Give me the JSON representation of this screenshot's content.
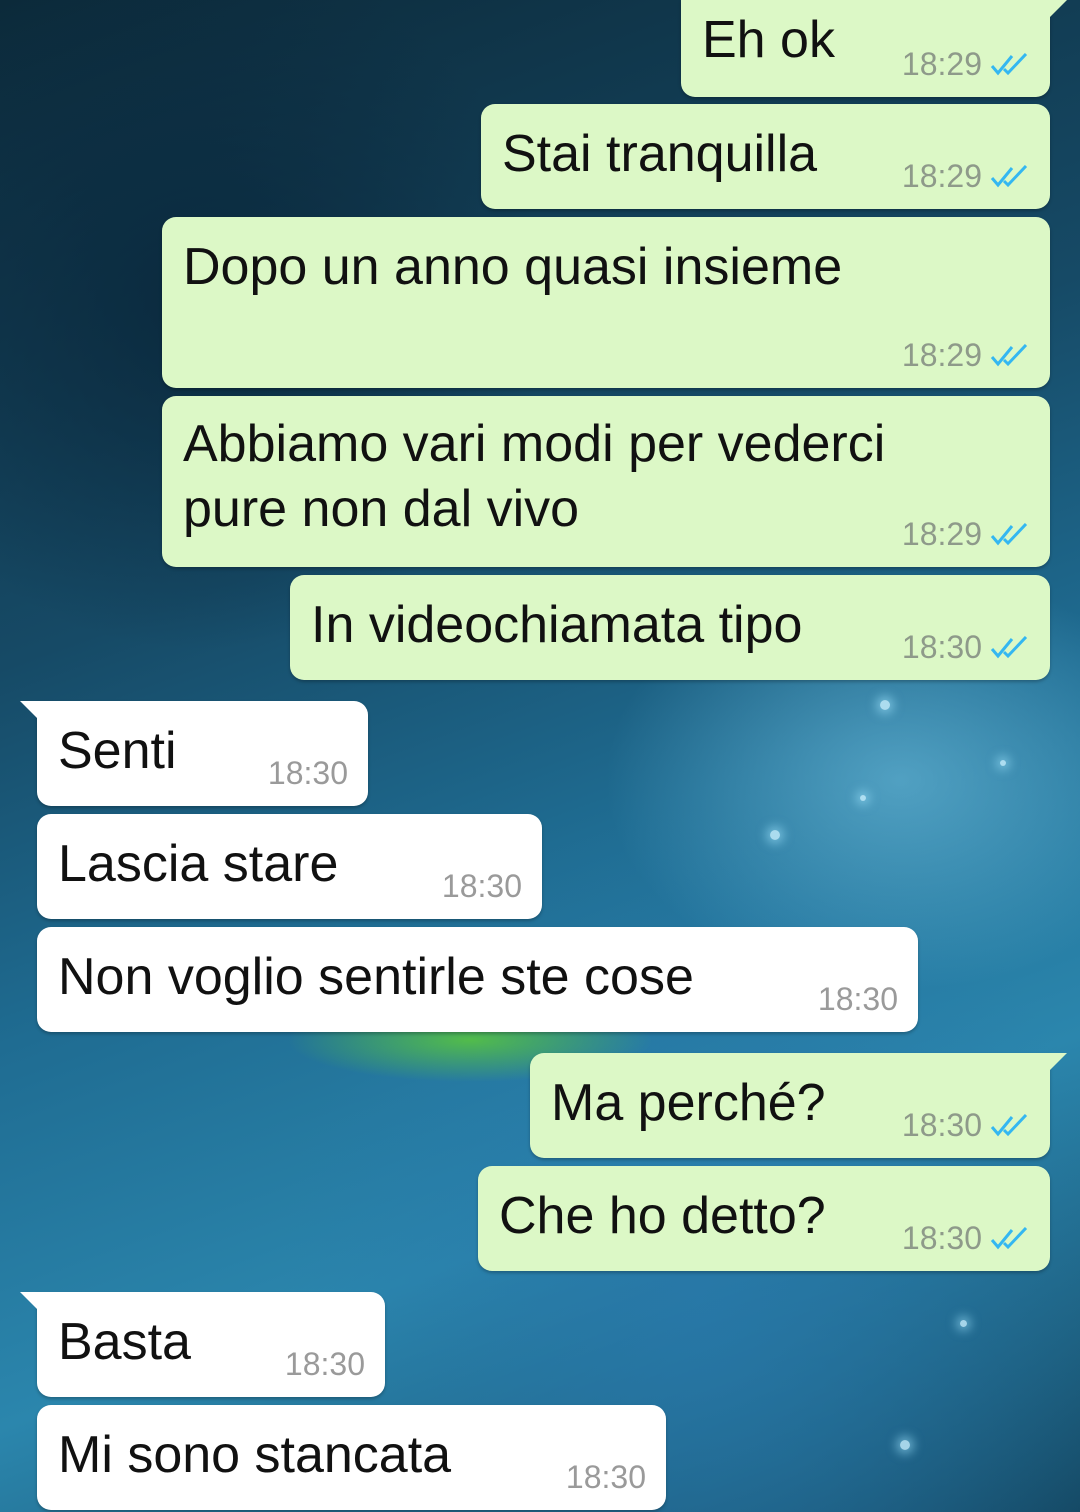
{
  "chat": {
    "messages": [
      {
        "direction": "outgoing",
        "text": "Eh ok",
        "time": "18:29",
        "status": "read-double-check-icon"
      },
      {
        "direction": "outgoing",
        "text": "Stai tranquilla",
        "time": "18:29",
        "status": "read-double-check-icon"
      },
      {
        "direction": "outgoing",
        "text": "Dopo un anno quasi insieme",
        "time": "18:29",
        "status": "read-double-check-icon"
      },
      {
        "direction": "outgoing",
        "text_line1": "Abbiamo vari modi per vederci",
        "text_line2": "pure non dal vivo",
        "time": "18:29",
        "status": "read-double-check-icon"
      },
      {
        "direction": "outgoing",
        "text": "In videochiamata tipo",
        "time": "18:30",
        "status": "read-double-check-icon"
      },
      {
        "direction": "incoming",
        "text": "Senti",
        "time": "18:30"
      },
      {
        "direction": "incoming",
        "text": "Lascia stare",
        "time": "18:30"
      },
      {
        "direction": "incoming",
        "text": "Non voglio sentirle ste cose",
        "time": "18:30"
      },
      {
        "direction": "outgoing",
        "text": "Ma perché?",
        "time": "18:30",
        "status": "read-double-check-icon"
      },
      {
        "direction": "outgoing",
        "text": "Che ho detto?",
        "time": "18:30",
        "status": "read-double-check-icon"
      },
      {
        "direction": "incoming",
        "text": "Basta",
        "time": "18:30"
      },
      {
        "direction": "incoming",
        "text": "Mi sono stancata",
        "time": "18:30"
      }
    ]
  },
  "colors": {
    "outgoing_bubble": "#dcf8c6",
    "incoming_bubble": "#ffffff",
    "read_check": "#34b7f1"
  }
}
